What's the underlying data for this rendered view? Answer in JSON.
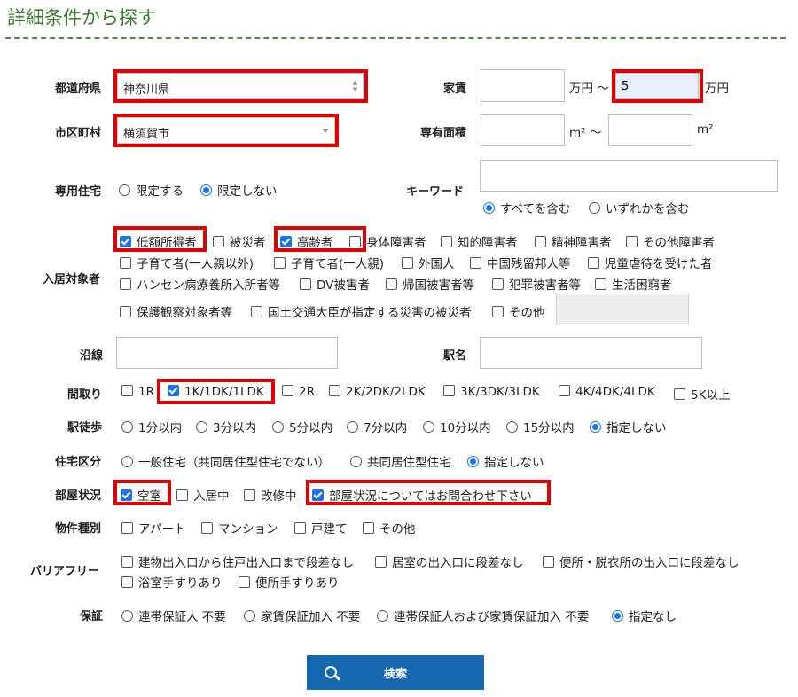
{
  "page": {
    "title": "詳細条件から探す"
  },
  "labels": {
    "prefecture": "都道府県",
    "city": "市区町村",
    "rent": "家賃",
    "area": "専有面積",
    "dedicated": "専用住宅",
    "keyword": "キーワード",
    "target": "入居対象者",
    "line": "沿線",
    "station": "駅名",
    "layout": "間取り",
    "walk": "駅徒歩",
    "housing_type": "住宅区分",
    "room_status": "部屋状況",
    "property_type": "物件種別",
    "barrier_free": "バリアフリー",
    "guarantee": "保証"
  },
  "prefecture": {
    "value": "神奈川県"
  },
  "city": {
    "value": "横須賀市"
  },
  "rent": {
    "min": "",
    "max": "5",
    "unit1": "万円 ～",
    "unit2": "万円"
  },
  "area": {
    "min": "",
    "max": "",
    "unit1": "m² ～",
    "unit2": "m²"
  },
  "keyword": {
    "value": ""
  },
  "dedicated": [
    "限定する",
    "限定しない"
  ],
  "keyword_mode": [
    "すべてを含む",
    "いずれかを含む"
  ],
  "target": {
    "row1": [
      "低額所得者",
      "被災者",
      "高齢者",
      "身体障害者",
      "知的障害者",
      "精神障害者",
      "その他障害者"
    ],
    "row2": [
      "子育て者(一人親以外)",
      "子育て者(一人親)",
      "外国人",
      "中国残留邦人等",
      "児童虐待を受けた者"
    ],
    "row3": [
      "ハンセン病療養所入所者等",
      "DV被害者",
      "帰国被害者等",
      "犯罪被害者等",
      "生活困窮者"
    ],
    "row4": [
      "保護観察対象者等",
      "国土交通大臣が指定する災害の被災者",
      "その他"
    ]
  },
  "line": {
    "value": ""
  },
  "station": {
    "value": ""
  },
  "layout": [
    "1R",
    "1K/1DK/1LDK",
    "2R",
    "2K/2DK/2LDK",
    "3K/3DK/3LDK",
    "4K/4DK/4LDK",
    "5K以上"
  ],
  "walk": [
    "1分以内",
    "3分以内",
    "5分以内",
    "7分以内",
    "10分以内",
    "15分以内",
    "指定しない"
  ],
  "housing_type": [
    "一般住宅（共同居住型住宅でない）",
    "共同居住型住宅",
    "指定しない"
  ],
  "room_status": [
    "空室",
    "入居中",
    "改修中",
    "部屋状況についてはお問合わせ下さい"
  ],
  "property_type": [
    "アパート",
    "マンション",
    "戸建て",
    "その他"
  ],
  "barrier_free": {
    "row1": [
      "建物出入口から住戸出入口まで段差なし",
      "居室の出入口に段差なし",
      "便所・脱衣所の出入口に段差なし"
    ],
    "row2": [
      "浴室手すりあり",
      "便所手すりあり"
    ]
  },
  "guarantee": [
    "連帯保証人 不要",
    "家賃保証加入 不要",
    "連帯保証人および家賃保証加入 不要",
    "指定なし"
  ],
  "search": {
    "label": "検索"
  },
  "colors": {
    "accent": "#1467b0",
    "highlight": "#e00000",
    "title": "#3e7a33"
  }
}
